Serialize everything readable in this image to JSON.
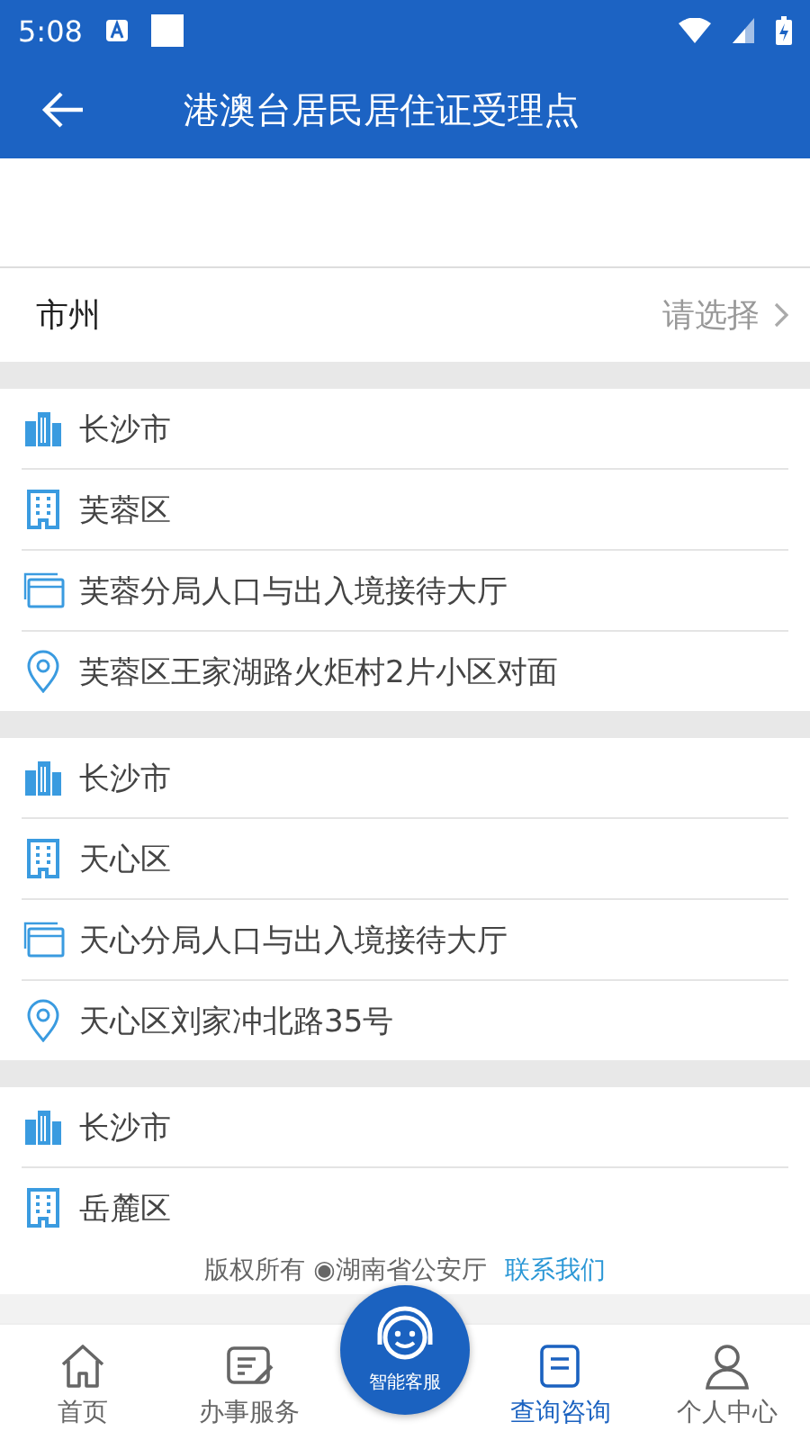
{
  "status_bar": {
    "time": "5:08"
  },
  "header": {
    "title": "港澳台居民居住证受理点"
  },
  "filter": {
    "label": "市州",
    "placeholder": "请选择"
  },
  "groups": [
    {
      "rows": [
        {
          "kind": "city",
          "text": "长沙市"
        },
        {
          "kind": "district",
          "text": "芙蓉区"
        },
        {
          "kind": "office",
          "text": "芙蓉分局人口与出入境接待大厅"
        },
        {
          "kind": "address",
          "text": "芙蓉区王家湖路火炬村2片小区对面"
        }
      ]
    },
    {
      "rows": [
        {
          "kind": "city",
          "text": "长沙市"
        },
        {
          "kind": "district",
          "text": "天心区"
        },
        {
          "kind": "office",
          "text": "天心分局人口与出入境接待大厅"
        },
        {
          "kind": "address",
          "text": "天心区刘家冲北路35号"
        }
      ]
    },
    {
      "rows": [
        {
          "kind": "city",
          "text": "长沙市"
        },
        {
          "kind": "district",
          "text": "岳麓区"
        }
      ]
    }
  ],
  "footer": {
    "copyright": "版权所有 ◉湖南省公安厅",
    "link": "联系我们"
  },
  "nav": {
    "items": [
      {
        "kind": "home",
        "label": "首页",
        "selected": false
      },
      {
        "kind": "service",
        "label": "办事服务",
        "selected": false
      },
      {
        "kind": "center",
        "label": "智能客服",
        "selected": false
      },
      {
        "kind": "query",
        "label": "查询咨询",
        "selected": true
      },
      {
        "kind": "user",
        "label": "个人中心",
        "selected": false
      }
    ]
  }
}
